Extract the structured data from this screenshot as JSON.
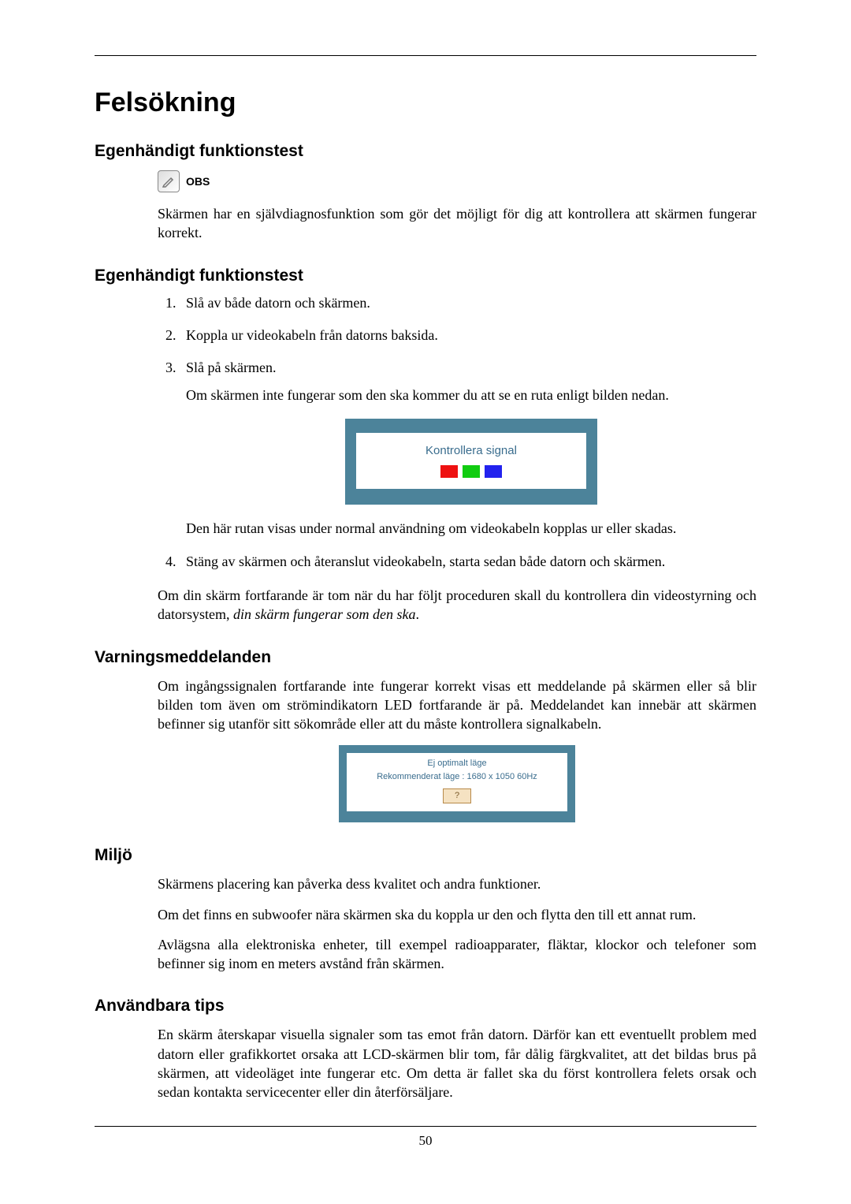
{
  "title": "Felsökning",
  "pageNumber": "50",
  "sections": {
    "s1": {
      "heading": "Egenhändigt funktionstest",
      "obsLabel": "OBS",
      "intro": "Skärmen har en självdiagnosfunktion som gör det möjligt för dig att kontrollera att skärmen fungerar korrekt."
    },
    "s2": {
      "heading": "Egenhändigt funktionstest",
      "steps": {
        "i1": "Slå av både datorn och skärmen.",
        "i2": "Koppla ur videokabeln från datorns baksida.",
        "i3": "Slå på skärmen.",
        "i3a": "Om skärmen inte fungerar som den ska kommer du att se en ruta enligt bilden nedan.",
        "signalTitle": "Kontrollera signal",
        "i3b": "Den här rutan visas under normal användning om videokabeln kopplas ur eller skadas.",
        "i4": "Stäng av skärmen och återanslut videokabeln, starta sedan både datorn och skärmen."
      },
      "outro1": "Om din skärm fortfarande är tom när du har följt proceduren skall du kontrollera din videostyrning och datorsystem, ",
      "outroItalic": "din skärm fungerar som den ska",
      "outroEnd": "."
    },
    "s3": {
      "heading": "Varningsmeddelanden",
      "p1": "Om ingångssignalen fortfarande inte fungerar korrekt visas ett meddelande på skärmen eller så blir bilden tom även om strömindikatorn LED fortfarande är på. Meddelandet kan innebär att skärmen befinner sig utanför sitt sökområde eller att du måste kontrollera signalkabeln.",
      "warn": {
        "line1": "Ej optimalt läge",
        "line2": "Rekommenderat läge : 1680 x 1050  60Hz",
        "btn": "?"
      }
    },
    "s4": {
      "heading": "Miljö",
      "p1": "Skärmens placering kan påverka dess kvalitet och andra funktioner.",
      "p2": "Om det finns en subwoofer nära skärmen ska du koppla ur den och flytta den till ett annat rum.",
      "p3": "Avlägsna alla elektroniska enheter, till exempel radioapparater, fläktar, klockor och telefoner som befinner sig inom en meters avstånd från skärmen."
    },
    "s5": {
      "heading": "Användbara tips",
      "p1": "En skärm återskapar visuella signaler som tas emot från datorn. Därför kan ett eventuellt problem med datorn eller grafikkortet orsaka att LCD-skärmen blir tom, får dålig färgkvalitet, att det bildas brus på skärmen, att videoläget inte fungerar etc. Om detta är fallet ska du först kontrollera felets orsak och sedan kontakta servicecenter eller din återförsäljare."
    }
  }
}
